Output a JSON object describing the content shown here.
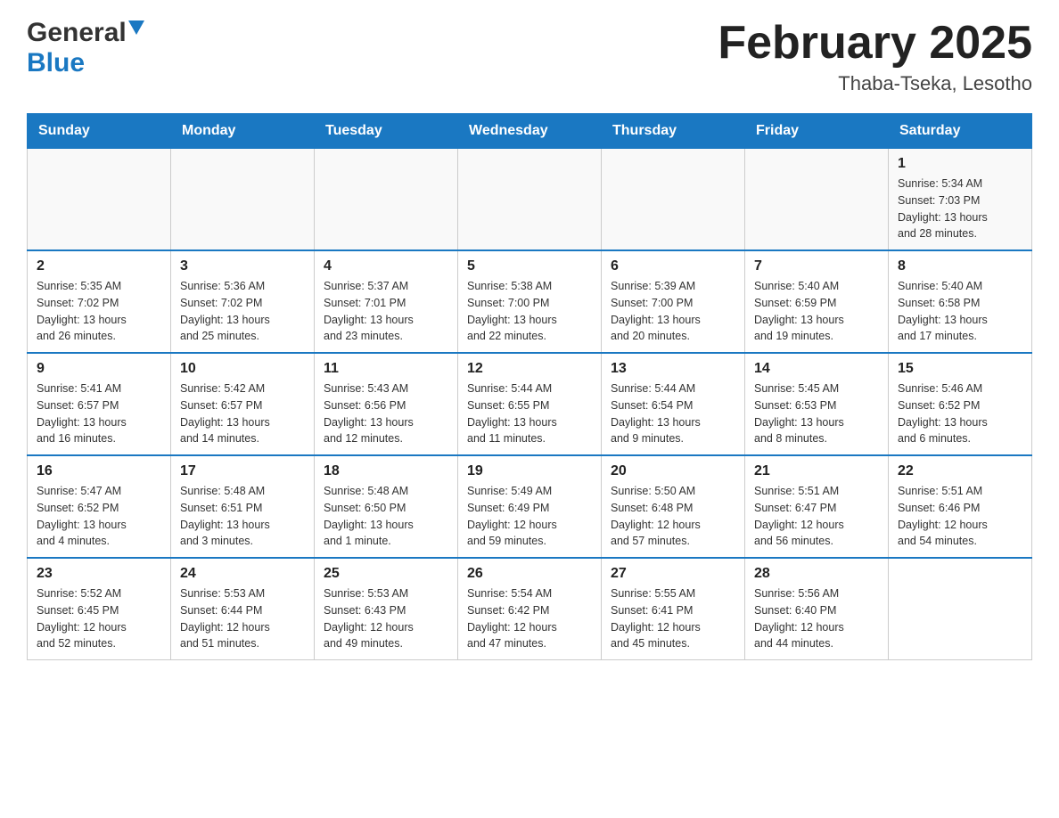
{
  "header": {
    "logo_general": "General",
    "logo_blue": "Blue",
    "month_title": "February 2025",
    "location": "Thaba-Tseka, Lesotho"
  },
  "weekdays": [
    "Sunday",
    "Monday",
    "Tuesday",
    "Wednesday",
    "Thursday",
    "Friday",
    "Saturday"
  ],
  "weeks": [
    [
      {
        "day": "",
        "info": ""
      },
      {
        "day": "",
        "info": ""
      },
      {
        "day": "",
        "info": ""
      },
      {
        "day": "",
        "info": ""
      },
      {
        "day": "",
        "info": ""
      },
      {
        "day": "",
        "info": ""
      },
      {
        "day": "1",
        "info": "Sunrise: 5:34 AM\nSunset: 7:03 PM\nDaylight: 13 hours\nand 28 minutes."
      }
    ],
    [
      {
        "day": "2",
        "info": "Sunrise: 5:35 AM\nSunset: 7:02 PM\nDaylight: 13 hours\nand 26 minutes."
      },
      {
        "day": "3",
        "info": "Sunrise: 5:36 AM\nSunset: 7:02 PM\nDaylight: 13 hours\nand 25 minutes."
      },
      {
        "day": "4",
        "info": "Sunrise: 5:37 AM\nSunset: 7:01 PM\nDaylight: 13 hours\nand 23 minutes."
      },
      {
        "day": "5",
        "info": "Sunrise: 5:38 AM\nSunset: 7:00 PM\nDaylight: 13 hours\nand 22 minutes."
      },
      {
        "day": "6",
        "info": "Sunrise: 5:39 AM\nSunset: 7:00 PM\nDaylight: 13 hours\nand 20 minutes."
      },
      {
        "day": "7",
        "info": "Sunrise: 5:40 AM\nSunset: 6:59 PM\nDaylight: 13 hours\nand 19 minutes."
      },
      {
        "day": "8",
        "info": "Sunrise: 5:40 AM\nSunset: 6:58 PM\nDaylight: 13 hours\nand 17 minutes."
      }
    ],
    [
      {
        "day": "9",
        "info": "Sunrise: 5:41 AM\nSunset: 6:57 PM\nDaylight: 13 hours\nand 16 minutes."
      },
      {
        "day": "10",
        "info": "Sunrise: 5:42 AM\nSunset: 6:57 PM\nDaylight: 13 hours\nand 14 minutes."
      },
      {
        "day": "11",
        "info": "Sunrise: 5:43 AM\nSunset: 6:56 PM\nDaylight: 13 hours\nand 12 minutes."
      },
      {
        "day": "12",
        "info": "Sunrise: 5:44 AM\nSunset: 6:55 PM\nDaylight: 13 hours\nand 11 minutes."
      },
      {
        "day": "13",
        "info": "Sunrise: 5:44 AM\nSunset: 6:54 PM\nDaylight: 13 hours\nand 9 minutes."
      },
      {
        "day": "14",
        "info": "Sunrise: 5:45 AM\nSunset: 6:53 PM\nDaylight: 13 hours\nand 8 minutes."
      },
      {
        "day": "15",
        "info": "Sunrise: 5:46 AM\nSunset: 6:52 PM\nDaylight: 13 hours\nand 6 minutes."
      }
    ],
    [
      {
        "day": "16",
        "info": "Sunrise: 5:47 AM\nSunset: 6:52 PM\nDaylight: 13 hours\nand 4 minutes."
      },
      {
        "day": "17",
        "info": "Sunrise: 5:48 AM\nSunset: 6:51 PM\nDaylight: 13 hours\nand 3 minutes."
      },
      {
        "day": "18",
        "info": "Sunrise: 5:48 AM\nSunset: 6:50 PM\nDaylight: 13 hours\nand 1 minute."
      },
      {
        "day": "19",
        "info": "Sunrise: 5:49 AM\nSunset: 6:49 PM\nDaylight: 12 hours\nand 59 minutes."
      },
      {
        "day": "20",
        "info": "Sunrise: 5:50 AM\nSunset: 6:48 PM\nDaylight: 12 hours\nand 57 minutes."
      },
      {
        "day": "21",
        "info": "Sunrise: 5:51 AM\nSunset: 6:47 PM\nDaylight: 12 hours\nand 56 minutes."
      },
      {
        "day": "22",
        "info": "Sunrise: 5:51 AM\nSunset: 6:46 PM\nDaylight: 12 hours\nand 54 minutes."
      }
    ],
    [
      {
        "day": "23",
        "info": "Sunrise: 5:52 AM\nSunset: 6:45 PM\nDaylight: 12 hours\nand 52 minutes."
      },
      {
        "day": "24",
        "info": "Sunrise: 5:53 AM\nSunset: 6:44 PM\nDaylight: 12 hours\nand 51 minutes."
      },
      {
        "day": "25",
        "info": "Sunrise: 5:53 AM\nSunset: 6:43 PM\nDaylight: 12 hours\nand 49 minutes."
      },
      {
        "day": "26",
        "info": "Sunrise: 5:54 AM\nSunset: 6:42 PM\nDaylight: 12 hours\nand 47 minutes."
      },
      {
        "day": "27",
        "info": "Sunrise: 5:55 AM\nSunset: 6:41 PM\nDaylight: 12 hours\nand 45 minutes."
      },
      {
        "day": "28",
        "info": "Sunrise: 5:56 AM\nSunset: 6:40 PM\nDaylight: 12 hours\nand 44 minutes."
      },
      {
        "day": "",
        "info": ""
      }
    ]
  ]
}
